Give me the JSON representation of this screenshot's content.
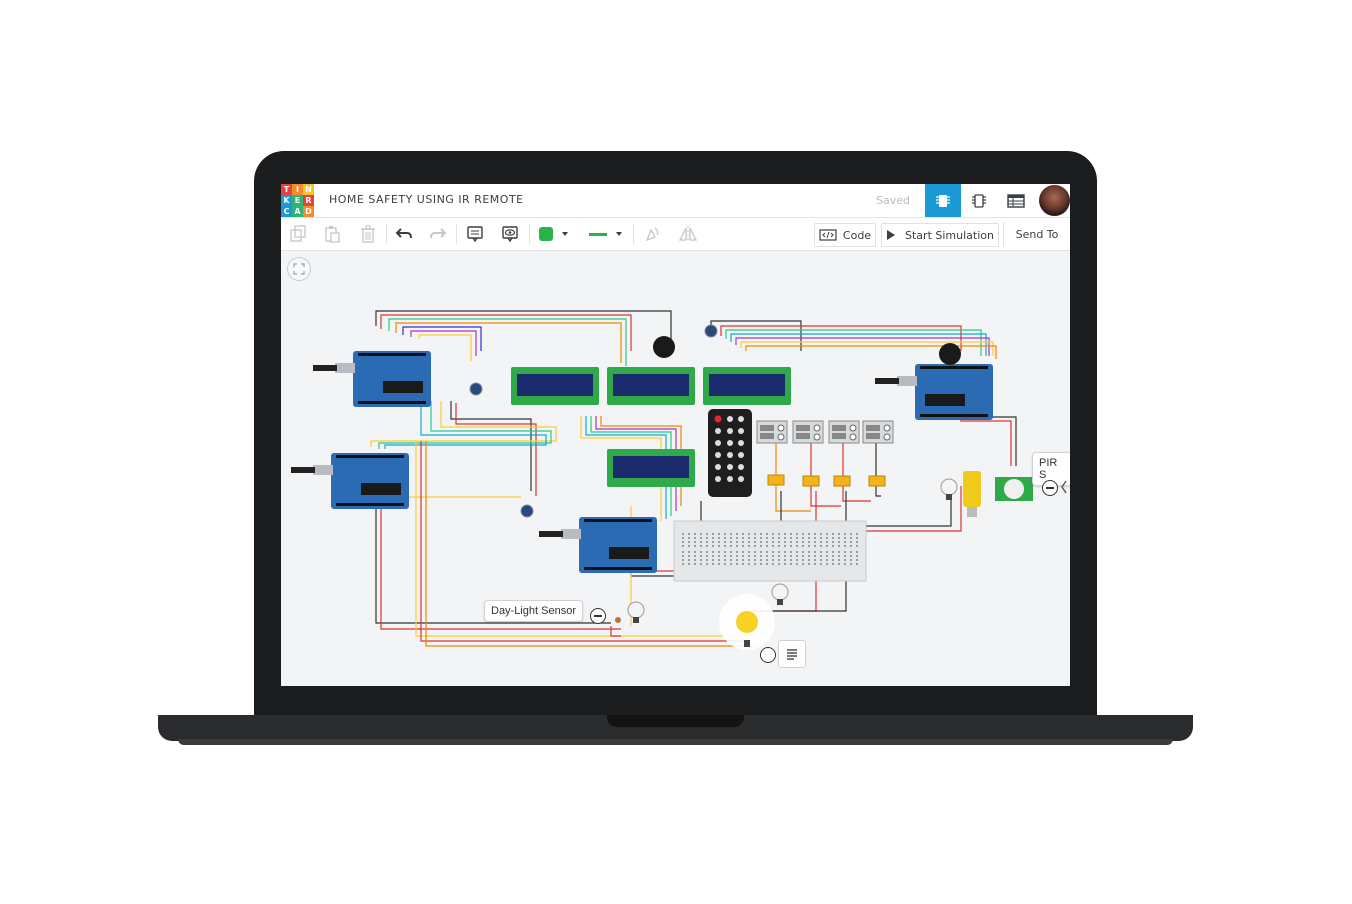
{
  "app": {
    "logo_letters": [
      "T",
      "I",
      "N",
      "K",
      "E",
      "R",
      "C",
      "A",
      "D"
    ],
    "logo_colors": [
      "#e8403a",
      "#f28b2e",
      "#f3c331",
      "#1c9ad6",
      "#2bb673",
      "#e8403a",
      "#1c9ad6",
      "#2bb673",
      "#f28b2e"
    ],
    "project_title": "HOME SAFETY USING IR REMOTE",
    "save_status": "Saved",
    "accent": "#1c9ad6"
  },
  "toolbar": {
    "code_label": "Code",
    "start_simulation_label": "Start Simulation",
    "send_to_label": "Send To",
    "fill_color": "#2bb34a",
    "wire_color": "#2bb34a"
  },
  "canvas": {
    "labels": {
      "day_light_sensor": "Day-Light Sensor",
      "pir_sensor": "PIR S"
    }
  }
}
